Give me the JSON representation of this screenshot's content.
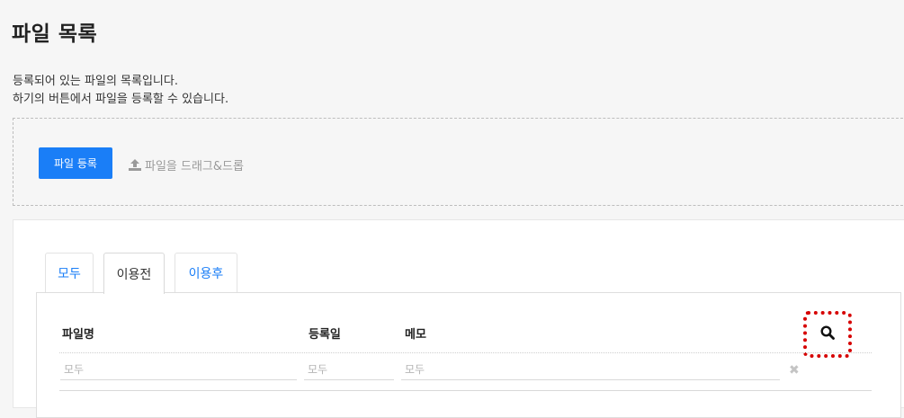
{
  "page": {
    "title": "파일 목록",
    "description_line1": "등록되어 있는 파일의 목록입니다.",
    "description_line2": "하기의 버튼에서 파일을 등록할 수 있습니다."
  },
  "upload": {
    "register_label": "파일 등록",
    "drag_hint": "파일을 드래그&드롭",
    "upload_icon": "upload-icon",
    "accent_color": "#1a7ef7"
  },
  "tabs": [
    {
      "label": "모두",
      "active": false
    },
    {
      "label": "이용전",
      "active": true
    },
    {
      "label": "이용후",
      "active": false
    }
  ],
  "table": {
    "columns": [
      "파일명",
      "등록일",
      "메모"
    ],
    "search_icon": "search-icon",
    "filters": {
      "name_placeholder": "모두",
      "date_placeholder": "모두",
      "memo_placeholder": "모두"
    },
    "clear_icon": "close-icon",
    "clear_glyph": "✖"
  }
}
